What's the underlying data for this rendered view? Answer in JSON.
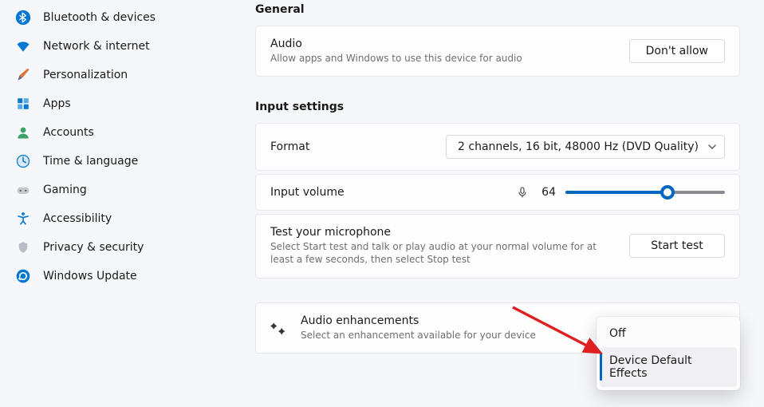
{
  "sidebar": {
    "items": [
      {
        "label": "Bluetooth & devices",
        "icon": "bluetooth"
      },
      {
        "label": "Network & internet",
        "icon": "wifi"
      },
      {
        "label": "Personalization",
        "icon": "brush"
      },
      {
        "label": "Apps",
        "icon": "apps"
      },
      {
        "label": "Accounts",
        "icon": "person"
      },
      {
        "label": "Time & language",
        "icon": "clock"
      },
      {
        "label": "Gaming",
        "icon": "game"
      },
      {
        "label": "Accessibility",
        "icon": "accessibility"
      },
      {
        "label": "Privacy & security",
        "icon": "shield"
      },
      {
        "label": "Windows Update",
        "icon": "update"
      }
    ]
  },
  "sections": {
    "general": {
      "heading": "General",
      "audio": {
        "title": "Audio",
        "desc": "Allow apps and Windows to use this device for audio",
        "button": "Don't allow"
      }
    },
    "input": {
      "heading": "Input settings",
      "format": {
        "title": "Format",
        "value": "2 channels, 16 bit, 48000 Hz (DVD Quality)"
      },
      "volume": {
        "title": "Input volume",
        "value": "64",
        "percent": 64
      },
      "mic_test": {
        "title": "Test your microphone",
        "desc": "Select Start test and talk or play audio at your normal volume for at least a few seconds, then select Stop test",
        "button": "Start test"
      }
    },
    "enhancements": {
      "title": "Audio enhancements",
      "desc": "Select an enhancement available for your device",
      "dropdown": {
        "options": [
          "Off",
          "Device Default Effects"
        ],
        "selected_index": 1
      }
    }
  },
  "colors": {
    "accent": "#0067c0"
  }
}
